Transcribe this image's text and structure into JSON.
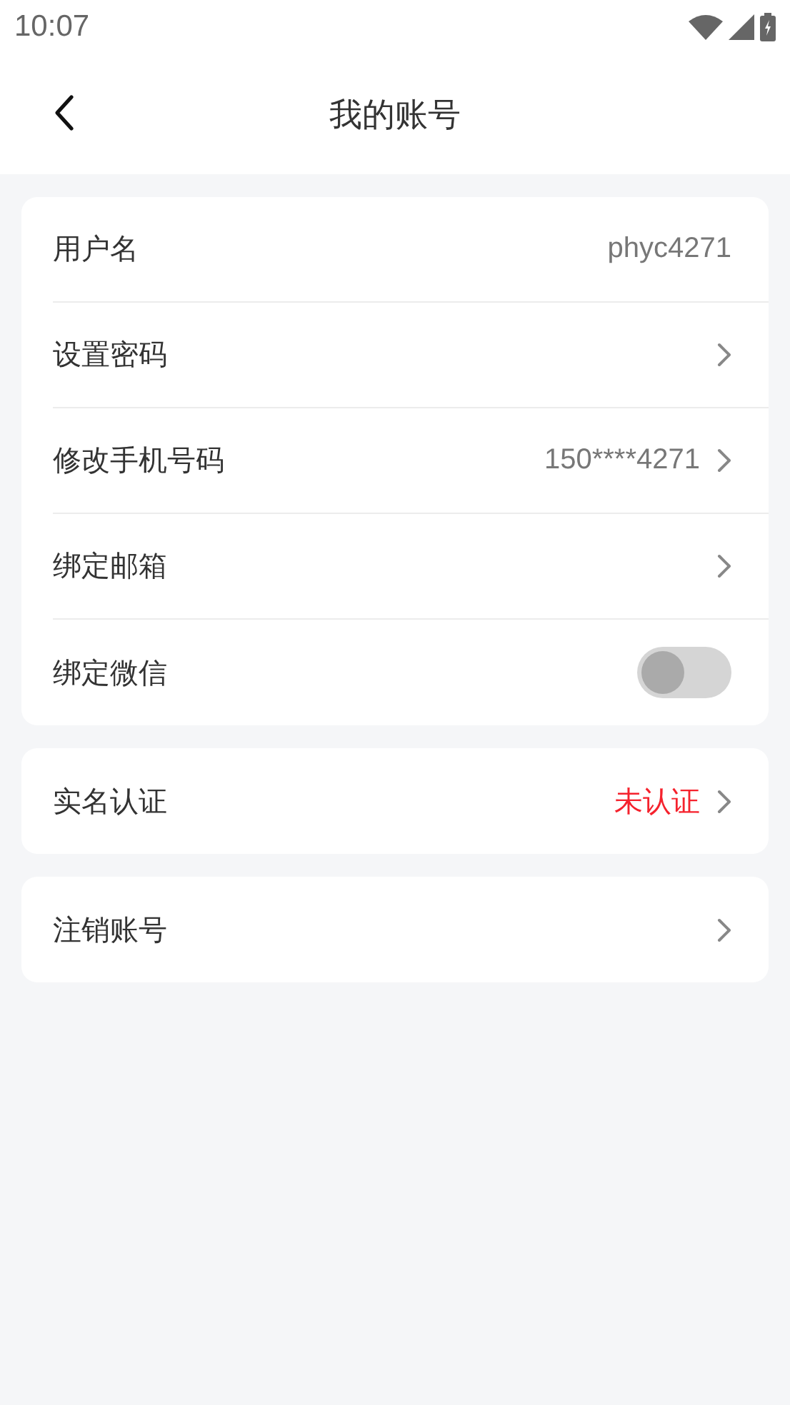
{
  "status_bar": {
    "time": "10:07"
  },
  "header": {
    "title": "我的账号"
  },
  "groups": [
    {
      "rows": [
        {
          "kind": "value",
          "label": "用户名",
          "value": "phyc4271",
          "alert": false,
          "chevron": false
        },
        {
          "kind": "link",
          "label": "设置密码",
          "chevron": true
        },
        {
          "kind": "value",
          "label": "修改手机号码",
          "value": "150****4271",
          "alert": false,
          "chevron": true
        },
        {
          "kind": "link",
          "label": "绑定邮箱",
          "chevron": true
        },
        {
          "kind": "toggle",
          "label": "绑定微信",
          "on": false
        }
      ]
    },
    {
      "rows": [
        {
          "kind": "value",
          "label": "实名认证",
          "value": "未认证",
          "alert": true,
          "chevron": true
        }
      ]
    },
    {
      "rows": [
        {
          "kind": "link",
          "label": "注销账号",
          "chevron": true
        }
      ]
    }
  ]
}
